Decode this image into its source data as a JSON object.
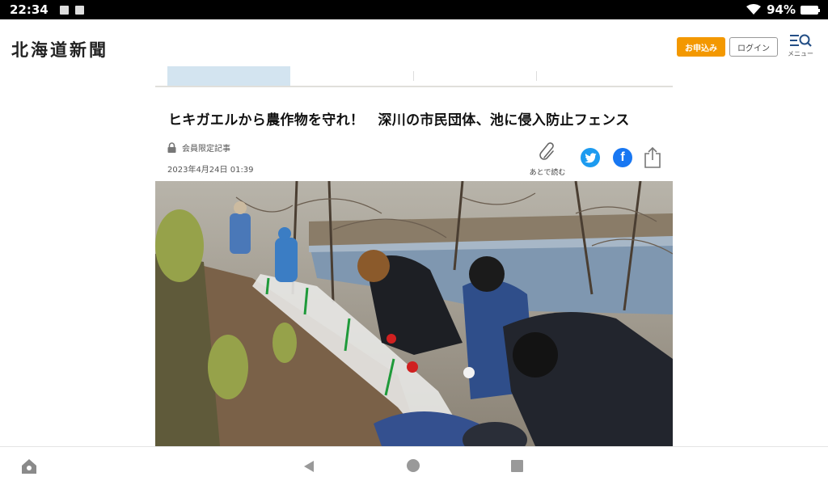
{
  "status_bar": {
    "time": "22:34",
    "battery": "94%"
  },
  "header": {
    "logo": "北海道新聞",
    "subscribe_label": "お申込み",
    "login_label": "ログイン",
    "menu_label": "メニュー"
  },
  "tabs": [
    {
      "color": "#234e85"
    },
    {
      "color": "#3aa040"
    },
    {
      "color": "#c0392b"
    },
    {
      "color": "#e0a030"
    }
  ],
  "article": {
    "title": "ヒキガエルから農作物を守れ！　深川の市民団体、池に侵入防止フェンス",
    "member_label": "会員限定記事",
    "date": "2023年4月24日 01:39",
    "read_later_label": "あとで読む",
    "facebook_glyph": "f"
  }
}
